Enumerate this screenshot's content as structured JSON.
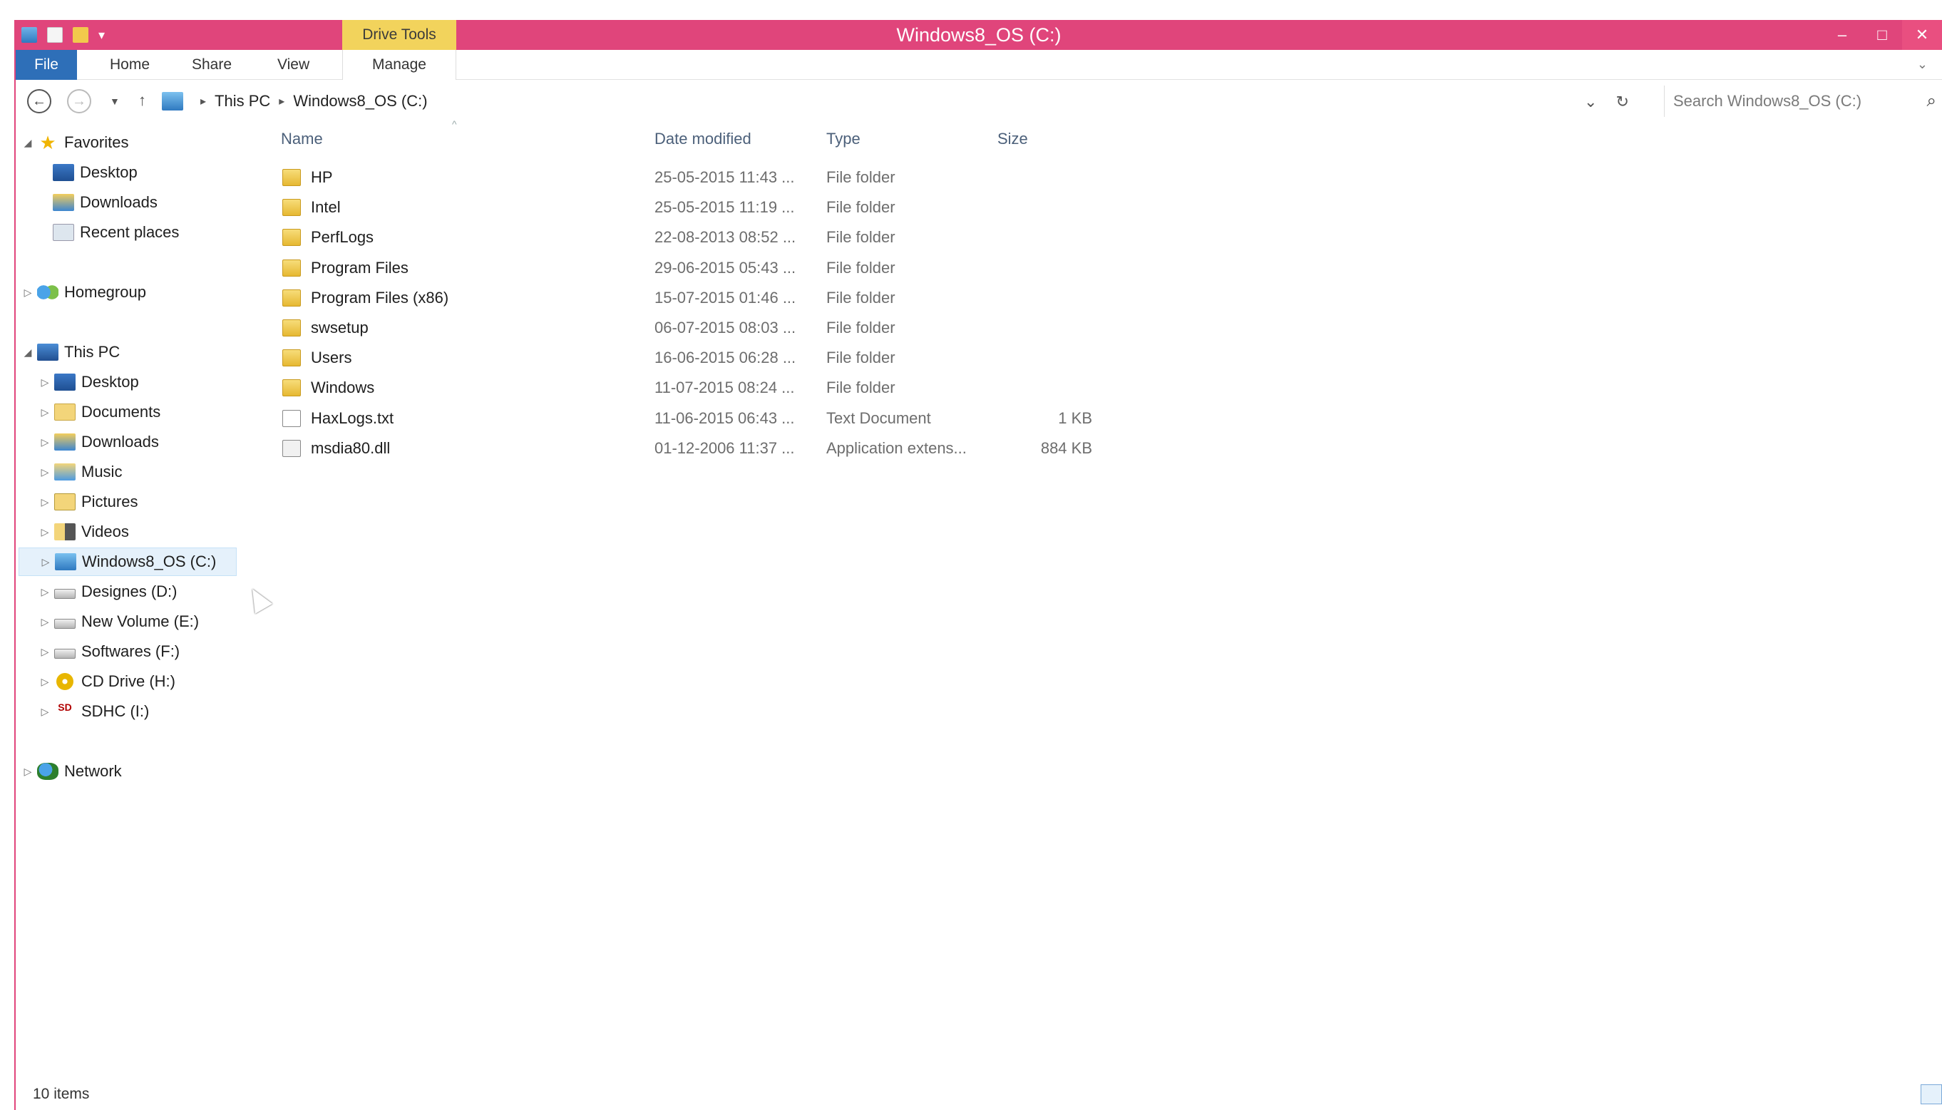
{
  "window": {
    "title": "Windows8_OS (C:)",
    "context_tab": "Drive Tools",
    "accent_color": "#e0457b"
  },
  "titlebar_buttons": {
    "minimize": "–",
    "maximize": "□",
    "close": "✕"
  },
  "ribbon": {
    "tabs": [
      "File",
      "Home",
      "Share",
      "View",
      "Manage"
    ]
  },
  "address": {
    "path": [
      "This PC",
      "Windows8_OS (C:)"
    ],
    "search_placeholder": "Search Windows8_OS (C:)"
  },
  "nav": {
    "favorites": "Favorites",
    "favorites_items": [
      "Desktop",
      "Downloads",
      "Recent places"
    ],
    "homegroup": "Homegroup",
    "thispc": "This PC",
    "thispc_items": [
      "Desktop",
      "Documents",
      "Downloads",
      "Music",
      "Pictures",
      "Videos",
      "Windows8_OS (C:)",
      "Designes (D:)",
      "New Volume (E:)",
      "Softwares (F:)",
      "CD Drive (H:)",
      "SDHC (I:)"
    ],
    "network": "Network",
    "selected": "Windows8_OS (C:)"
  },
  "columns": [
    "Name",
    "Date modified",
    "Type",
    "Size"
  ],
  "files": [
    {
      "name": "HP",
      "date": "25-05-2015 11:43 ...",
      "type": "File folder",
      "size": "",
      "icon": "folder-icon"
    },
    {
      "name": "Intel",
      "date": "25-05-2015 11:19 ...",
      "type": "File folder",
      "size": "",
      "icon": "folder-icon"
    },
    {
      "name": "PerfLogs",
      "date": "22-08-2013 08:52 ...",
      "type": "File folder",
      "size": "",
      "icon": "folder-icon"
    },
    {
      "name": "Program Files",
      "date": "29-06-2015 05:43 ...",
      "type": "File folder",
      "size": "",
      "icon": "folder-icon"
    },
    {
      "name": "Program Files (x86)",
      "date": "15-07-2015 01:46 ...",
      "type": "File folder",
      "size": "",
      "icon": "folder-icon"
    },
    {
      "name": "swsetup",
      "date": "06-07-2015 08:03 ...",
      "type": "File folder",
      "size": "",
      "icon": "folder-icon"
    },
    {
      "name": "Users",
      "date": "16-06-2015 06:28 ...",
      "type": "File folder",
      "size": "",
      "icon": "folder-icon"
    },
    {
      "name": "Windows",
      "date": "11-07-2015 08:24 ...",
      "type": "File folder",
      "size": "",
      "icon": "folder-icon"
    },
    {
      "name": "HaxLogs.txt",
      "date": "11-06-2015 06:43 ...",
      "type": "Text Document",
      "size": "1 KB",
      "icon": "text-file-icon"
    },
    {
      "name": "msdia80.dll",
      "date": "01-12-2006 11:37 ...",
      "type": "Application extens...",
      "size": "884 KB",
      "icon": "dll-file-icon"
    }
  ],
  "status": {
    "item_count": "10 items"
  }
}
